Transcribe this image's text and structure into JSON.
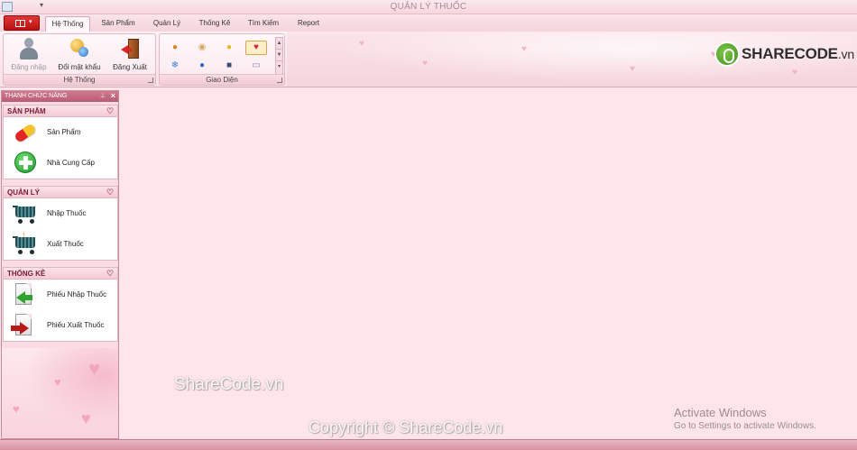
{
  "window": {
    "title": "QUẢN LÝ THUỐC"
  },
  "tabs": [
    {
      "label": "Hệ Thống",
      "active": true
    },
    {
      "label": "Sản Phẩm"
    },
    {
      "label": "Quản Lý"
    },
    {
      "label": "Thống Kê"
    },
    {
      "label": "Tìm Kiếm"
    },
    {
      "label": "Report"
    }
  ],
  "ribbon": {
    "system_group": {
      "label": "Hệ Thống",
      "buttons": [
        {
          "label": "Đăng nhập",
          "icon": "user-login-icon",
          "enabled": false
        },
        {
          "label": "Đổi mật khẩu",
          "icon": "change-password-icon",
          "enabled": true
        },
        {
          "label": "Đăng Xuất",
          "icon": "logout-door-icon",
          "enabled": true
        }
      ]
    },
    "theme_group": {
      "label": "Giao Diện",
      "swatches": [
        "pumpkin-skin",
        "caramel-skin",
        "gold-skin",
        "valentine-skin",
        "snowflake-skin",
        "blue-apple-skin",
        "dark-blue-skin",
        "lilian-skin"
      ],
      "selected": "valentine-skin"
    }
  },
  "logo": {
    "brand": "SHARECODE",
    "suffix": ".vn"
  },
  "side_panel": {
    "title": "THANH CHỨC NĂNG",
    "groups": [
      {
        "caption": "SẢN PHẨM",
        "items": [
          {
            "label": "Sản Phẩm",
            "icon": "pill-capsule-icon"
          },
          {
            "label": "Nhà Cung Cấp",
            "icon": "green-plus-icon"
          }
        ]
      },
      {
        "caption": "QUẢN LÝ",
        "items": [
          {
            "label": "Nhập Thuốc",
            "icon": "cart-in-icon"
          },
          {
            "label": "Xuất Thuốc",
            "icon": "cart-out-icon"
          }
        ]
      },
      {
        "caption": "THỐNG KÊ",
        "items": [
          {
            "label": "Phiếu Nhập Thuốc",
            "icon": "document-import-icon"
          },
          {
            "label": "Phiếu Xuất Thuốc",
            "icon": "document-export-icon"
          }
        ]
      }
    ]
  },
  "overlays": {
    "watermark": "ShareCode.vn",
    "copyright": "Copyright © ShareCode.vn",
    "activate_title": "Activate Windows",
    "activate_sub": "Go to Settings to activate Windows."
  },
  "colors": {
    "accent": "#b85c74",
    "background": "#fde5e9",
    "app_menu": "#c81f1f"
  }
}
